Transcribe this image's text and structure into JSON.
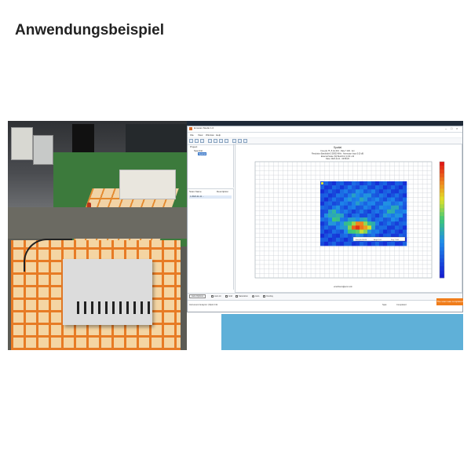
{
  "page": {
    "heading": "Anwendungsbeispiel"
  },
  "software": {
    "window_title": "Emscan Studio 1.0",
    "menu": [
      "File",
      "View",
      "Window",
      "Help"
    ],
    "tree": {
      "root": "Project",
      "child": "Spectral",
      "selected": "Spatial"
    },
    "table_headers": {
      "col1": "Scan Name",
      "col2": "Description"
    },
    "table_row": "1  2022-11-11 ...",
    "plot": {
      "title": "Spatial",
      "info_lines": [
        "Freq (1) 75 -5 (2) 46.0 · Rate 7.100 · Ant",
        "Resolution Bandwidth 5.00000 MHz · Attenuator Input 5.00 dB",
        "External Scale: (M) Bus/Ch1 (1) 30 x 20",
        "Date: 2022-11-11 · 09:59:26"
      ],
      "marker_label": "Freq 46.230 M",
      "marker_value": "Ampl 4.00",
      "marker_extra": "Proj 7.100",
      "x_axis_title": "emcdrivers@emc.com"
    },
    "status_bar": {
      "dropdown": "Auto Options",
      "options": [
        "Auto Hi",
        "Grid",
        "Saturation",
        "Auto",
        "Overlay"
      ]
    },
    "bottom_bar": {
      "left": "Instrument Analyzer: (M)A1 F11",
      "right_a": "Spat",
      "right_b": "Completed"
    },
    "orange_button": "The scan was completed !"
  },
  "colors": {
    "accent_orange": "#f07d1b",
    "selection_blue": "#3b78c8",
    "heatmap_low": "#1a2fd6",
    "heatmap_high": "#e3130f"
  }
}
